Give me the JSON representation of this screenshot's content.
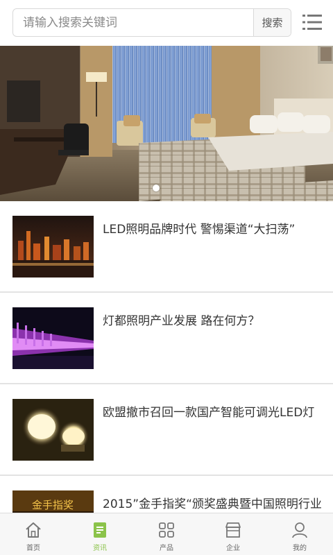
{
  "search": {
    "placeholder": "请输入搜索关键词",
    "button_label": "搜索"
  },
  "banner": {
    "active_slide": 1,
    "slide_count": 1
  },
  "news": [
    {
      "title": "LED照明品牌时代 警惕渠道“大扫荡”",
      "thumb": "city-night-skyline"
    },
    {
      "title": "灯都照明产业发展 路在何方？",
      "thumb": "purple-lit-promenade"
    },
    {
      "title": "欧盟撤市召回一款国产智能可调光LED灯",
      "thumb": "glowing-led-bulbs"
    },
    {
      "title": "2015”金手指奖“颁奖盛典暨中国照明行业",
      "thumb": "golden-award-banner",
      "thumb_text": "金手指奖"
    }
  ],
  "bottom_nav": [
    {
      "label": "首页",
      "icon": "home-icon",
      "active": false
    },
    {
      "label": "资讯",
      "icon": "news-icon",
      "active": true
    },
    {
      "label": "产品",
      "icon": "grid-icon",
      "active": false
    },
    {
      "label": "企业",
      "icon": "store-icon",
      "active": false
    },
    {
      "label": "我的",
      "icon": "user-icon",
      "active": false
    }
  ],
  "colors": {
    "accent": "#8bc34a",
    "nav_inactive": "#666666",
    "divider": "#e3e3e3"
  }
}
